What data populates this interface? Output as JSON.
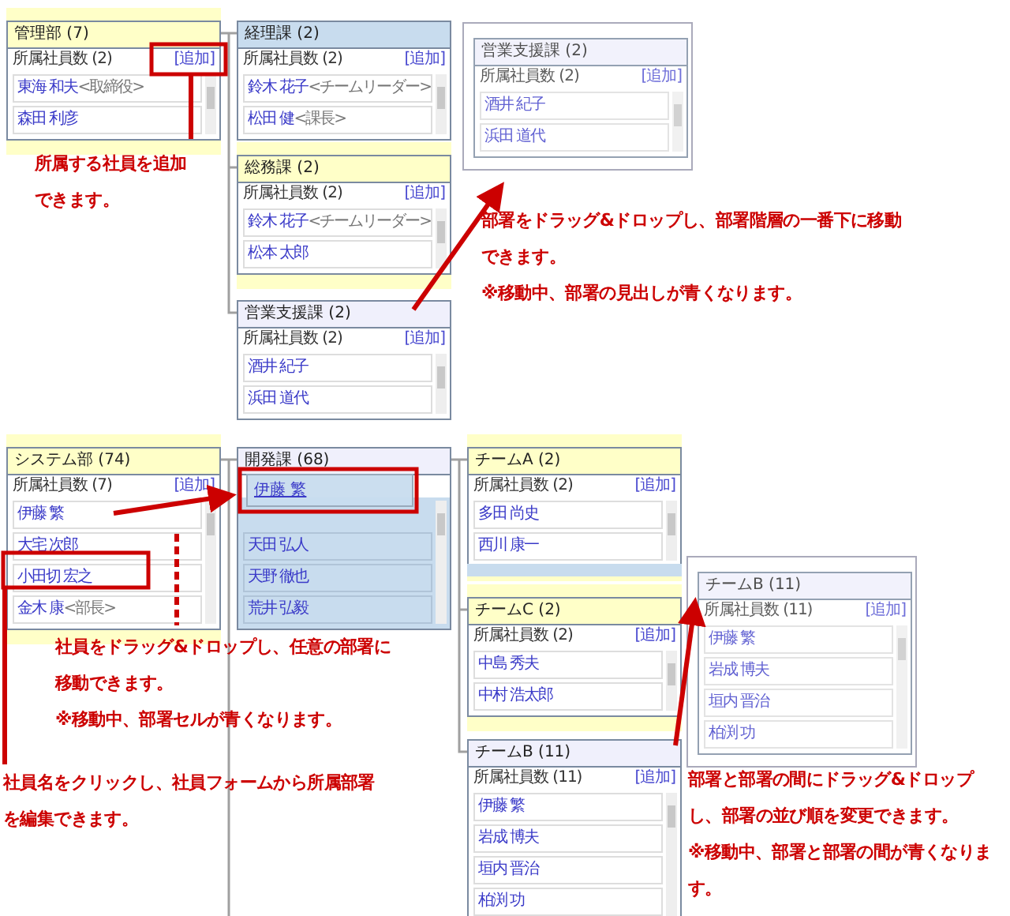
{
  "cards": [
    {
      "kind": "card",
      "heading_highlighted": false,
      "heading_shaded": true,
      "title": "管理部 (7)",
      "member_label": "所属社員数 (2)",
      "add_link": "[追加]",
      "members": [
        {
          "name": "東海 和夫",
          "role": "<取締役>"
        },
        {
          "name": "森田 利彦"
        }
      ]
    },
    {
      "kind": "card",
      "heading_highlighted": true,
      "heading_shaded": false,
      "title": "経理課 (2)",
      "member_label": "所属社員数 (2)",
      "add_link": "[追加]",
      "members": [
        {
          "name": "鈴木 花子",
          "role": "<チームリーダー>"
        },
        {
          "name": "松田 健",
          "role": "<課長>"
        }
      ]
    },
    {
      "kind": "card",
      "heading_highlighted": false,
      "heading_shaded": true,
      "title": "総務課 (2)",
      "member_label": "所属社員数 (2)",
      "add_link": "[追加]",
      "members": [
        {
          "name": "鈴木 花子",
          "role": "<チームリーダー>"
        },
        {
          "name": "松本 太郎"
        }
      ]
    },
    {
      "kind": "card",
      "heading_highlighted": false,
      "heading_shaded": false,
      "title": "営業支援課 (2)",
      "member_label": "所属社員数 (2)",
      "add_link": "[追加]",
      "members": [
        {
          "name": "酒井 紀子"
        },
        {
          "name": "浜田 道代"
        }
      ]
    },
    {
      "kind": "drag_preview",
      "heading_highlighted": false,
      "heading_shaded": false,
      "title": "営業支援課 (2)",
      "member_label": "所属社員数 (2)",
      "add_link": "[追加]",
      "members": [
        {
          "name": "酒井 紀子"
        },
        {
          "name": "浜田 道代"
        }
      ]
    },
    {
      "kind": "card",
      "heading_highlighted": false,
      "heading_shaded": true,
      "title": "システム部 (74)",
      "member_label": "所属社員数 (7)",
      "add_link": "[追加]",
      "members": [
        {
          "name": "伊藤 繁"
        },
        {
          "name": "大宅 次郎"
        },
        {
          "name": "小田切 宏之"
        },
        {
          "name": "金木 康",
          "role": "<部長>"
        }
      ]
    },
    {
      "kind": "card",
      "heading_highlighted": false,
      "heading_shaded": false,
      "title": "開発課 (68)",
      "list_highlighted": true,
      "members": [
        {
          "name": "天田 弘人"
        },
        {
          "name": "天野 徹也"
        },
        {
          "name": "荒井 弘毅"
        }
      ]
    },
    {
      "kind": "card",
      "heading_highlighted": false,
      "heading_shaded": true,
      "title": "チームA (2)",
      "member_label": "所属社員数 (2)",
      "add_link": "[追加]",
      "members": [
        {
          "name": "多田 尚史"
        },
        {
          "name": "西川 康一"
        }
      ]
    },
    {
      "kind": "card",
      "heading_highlighted": false,
      "heading_shaded": true,
      "title": "チームC (2)",
      "member_label": "所属社員数 (2)",
      "add_link": "[追加]",
      "drop_gap_above": true,
      "members": [
        {
          "name": "中島 秀夫"
        },
        {
          "name": "中村 浩太郎"
        }
      ]
    },
    {
      "kind": "card",
      "heading_highlighted": false,
      "heading_shaded": false,
      "title": "チームB (11)",
      "member_label": "所属社員数 (11)",
      "add_link": "[追加]",
      "members": [
        {
          "name": "伊藤 繁"
        },
        {
          "name": "岩成 博夫"
        },
        {
          "name": "垣内 晋治"
        },
        {
          "name": "柏渕 功"
        }
      ]
    },
    {
      "kind": "drag_preview",
      "heading_highlighted": false,
      "heading_shaded": false,
      "title": "チームB (11)",
      "member_label": "所属社員数 (11)",
      "add_link": "[追加]",
      "members": [
        {
          "name": "伊藤 繁"
        },
        {
          "name": "岩成 博夫"
        },
        {
          "name": "垣内 晋治"
        },
        {
          "name": "柏渕 功"
        }
      ]
    }
  ],
  "employee_drag_preview": {
    "name": "伊藤 繁"
  },
  "annotations": [
    {
      "lines": [
        "所属する社員を追加",
        "できます。"
      ]
    },
    {
      "lines": [
        "部署をドラッグ&ドロップし、部署階層の一番下に移動",
        "できます。",
        "※移動中、部署の見出しが青くなります。"
      ]
    },
    {
      "lines": [
        "社員をドラッグ&ドロップし、任意の部署に",
        "移動できます。",
        "※移動中、部署セルが青くなります。"
      ]
    },
    {
      "lines": [
        "社員名をクリックし、社員フォームから所属部署",
        "を編集できます。"
      ]
    },
    {
      "lines": [
        "部署と部署の間にドラッグ&ドロップ",
        "し、部署の並び順を変更できます。",
        "※移動中、部署と部署の間が青くなりま",
        "す。"
      ]
    }
  ]
}
